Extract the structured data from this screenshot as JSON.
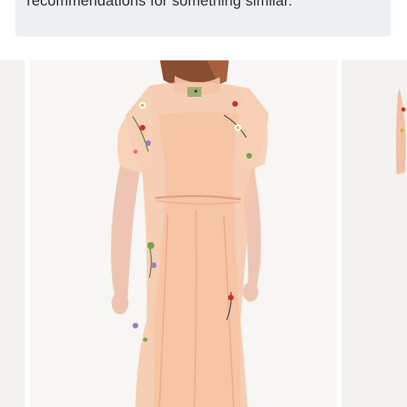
{
  "notice": {
    "text": "recommendations for something similar."
  },
  "gallery": {
    "images": [
      {
        "name": "previous-product-photo"
      },
      {
        "name": "main-product-photo"
      },
      {
        "name": "next-product-photo"
      }
    ]
  }
}
